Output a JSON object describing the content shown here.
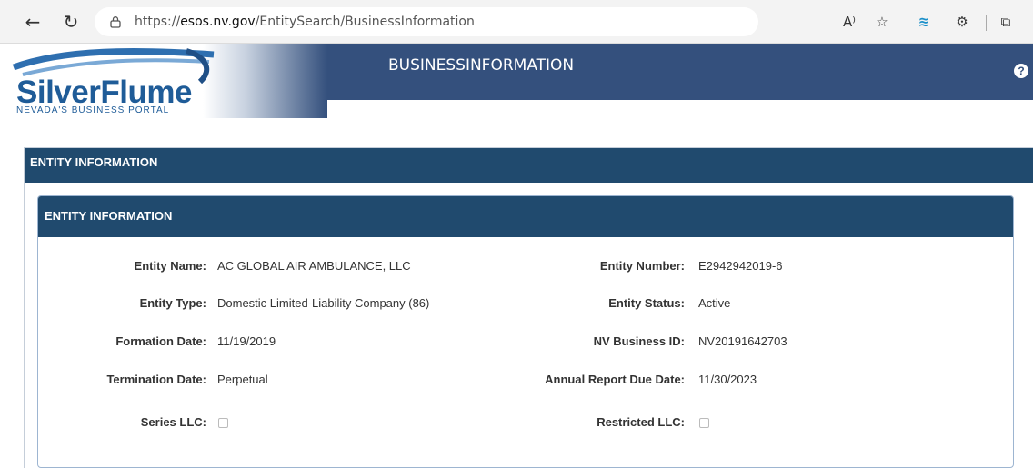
{
  "browser": {
    "back_icon": "←",
    "reload_icon": "↻",
    "url_prefix": "https://",
    "url_host": "esos.nv.gov",
    "url_path": "/EntitySearch/BusinessInformation",
    "read_aloud_icon": "A⁾",
    "favorites_icon": "☆",
    "extension_icon": "≋",
    "extensions_icon": "⚙",
    "collections_icon": "⧉"
  },
  "header": {
    "logo_text": "SilverFlume",
    "logo_tagline": "NEVADA'S BUSINESS PORTAL",
    "title": "BUSINESSINFORMATION",
    "help_icon": "?"
  },
  "outer_panel": {
    "title": "ENTITY INFORMATION"
  },
  "inner_panel": {
    "title": "ENTITY INFORMATION",
    "fields": {
      "entity_name": {
        "label": "Entity Name:",
        "value": "AC GLOBAL AIR AMBULANCE, LLC"
      },
      "entity_number": {
        "label": "Entity Number:",
        "value": "E2942942019-6"
      },
      "entity_type": {
        "label": "Entity Type:",
        "value": "Domestic Limited-Liability Company (86)"
      },
      "entity_status": {
        "label": "Entity Status:",
        "value": "Active"
      },
      "formation_date": {
        "label": "Formation Date:",
        "value": "11/19/2019"
      },
      "nv_business_id": {
        "label": "NV Business ID:",
        "value": "NV20191642703"
      },
      "termination_date": {
        "label": "Termination Date:",
        "value": "Perpetual"
      },
      "annual_report_due": {
        "label": "Annual Report Due Date:",
        "value": "11/30/2023"
      },
      "series_llc": {
        "label": "Series LLC:",
        "checked": false
      },
      "restricted_llc": {
        "label": "Restricted LLC:",
        "checked": false
      }
    }
  },
  "colors": {
    "header_bg": "#34507d",
    "panel_head_bg": "#204a6e",
    "logo_blue": "#1f5c98"
  }
}
